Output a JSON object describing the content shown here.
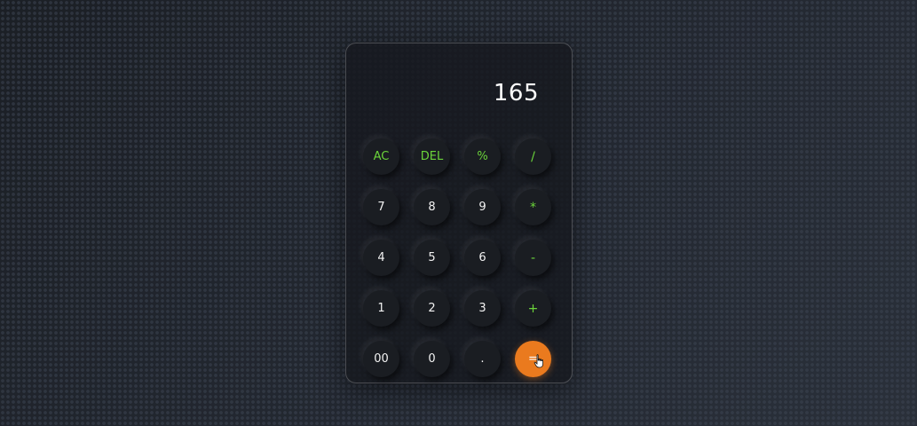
{
  "display": {
    "value": "165"
  },
  "keys": [
    {
      "label": "AC",
      "kind": "fn",
      "name": "clear-button"
    },
    {
      "label": "DEL",
      "kind": "fn",
      "name": "delete-button"
    },
    {
      "label": "%",
      "kind": "fn",
      "name": "percent-button"
    },
    {
      "label": "/",
      "kind": "op",
      "name": "divide-button"
    },
    {
      "label": "7",
      "kind": "num",
      "name": "digit-7-button"
    },
    {
      "label": "8",
      "kind": "num",
      "name": "digit-8-button"
    },
    {
      "label": "9",
      "kind": "num",
      "name": "digit-9-button"
    },
    {
      "label": "*",
      "kind": "op",
      "name": "multiply-button"
    },
    {
      "label": "4",
      "kind": "num",
      "name": "digit-4-button"
    },
    {
      "label": "5",
      "kind": "num",
      "name": "digit-5-button"
    },
    {
      "label": "6",
      "kind": "num",
      "name": "digit-6-button"
    },
    {
      "label": "-",
      "kind": "op",
      "name": "subtract-button"
    },
    {
      "label": "1",
      "kind": "num",
      "name": "digit-1-button"
    },
    {
      "label": "2",
      "kind": "num",
      "name": "digit-2-button"
    },
    {
      "label": "3",
      "kind": "num",
      "name": "digit-3-button"
    },
    {
      "label": "+",
      "kind": "op",
      "name": "add-button"
    },
    {
      "label": "00",
      "kind": "num",
      "name": "double-zero-button"
    },
    {
      "label": "0",
      "kind": "num",
      "name": "digit-0-button"
    },
    {
      "label": ".",
      "kind": "num",
      "name": "decimal-button"
    },
    {
      "label": "=",
      "kind": "equals",
      "name": "equals-button"
    }
  ],
  "colors": {
    "accent_green": "#6bd43a",
    "equals_orange": "#ea7a1e",
    "display_text": "#ffffff"
  },
  "icons": {
    "cursor": "hand-pointer-icon"
  }
}
